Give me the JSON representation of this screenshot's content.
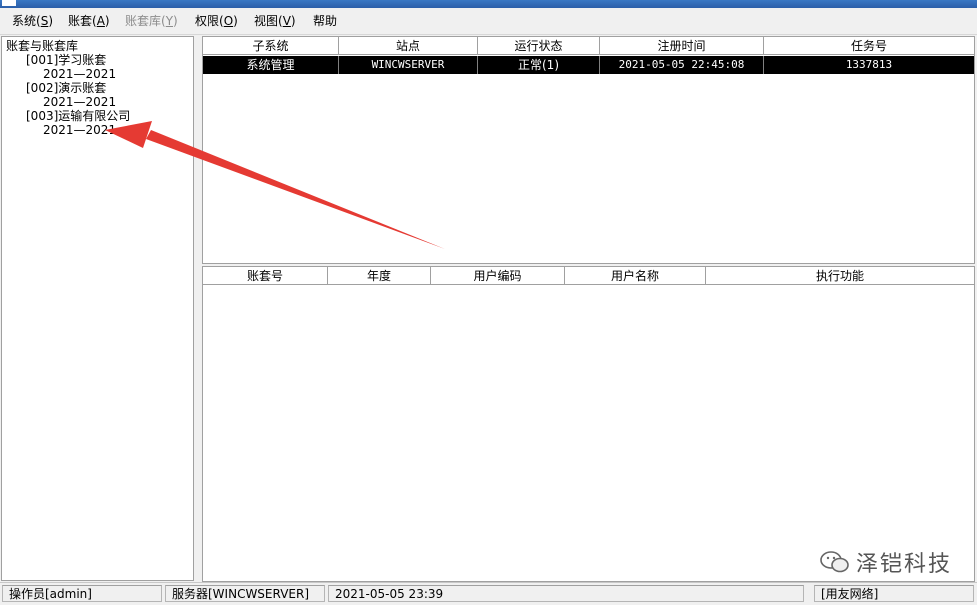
{
  "menubar": {
    "items": [
      {
        "label": "系统(",
        "key": "S",
        "tail": ")"
      },
      {
        "label": "账套(",
        "key": "A",
        "tail": ")"
      },
      {
        "label": "账套库(",
        "key": "Y",
        "tail": ")"
      },
      {
        "label": "权限(",
        "key": "O",
        "tail": ")"
      },
      {
        "label": "视图(",
        "key": "V",
        "tail": ")"
      },
      {
        "label": "帮助",
        "key": "",
        "tail": ""
      }
    ]
  },
  "tree": {
    "root": "账套与账套库",
    "accounts": [
      {
        "label": "[001]学习账套",
        "year": "2021—2021"
      },
      {
        "label": "[002]演示账套",
        "year": "2021—2021"
      },
      {
        "label": "[003]运输有限公司",
        "year": "2021—2021"
      }
    ]
  },
  "top_table": {
    "columns": [
      "子系统",
      "站点",
      "运行状态",
      "注册时间",
      "任务号"
    ],
    "rows": [
      [
        "系统管理",
        "WINCWSERVER",
        "正常(1)",
        "2021-05-05 22:45:08",
        "1337813"
      ]
    ]
  },
  "bottom_table": {
    "columns": [
      "账套号",
      "年度",
      "用户编码",
      "用户名称",
      "执行功能"
    ]
  },
  "watermark": {
    "text": "泽铠科技"
  },
  "statusbar": {
    "operator": "操作员[admin]",
    "server": "服务器[WINCWSERVER]",
    "datetime": "2021-05-05 23:39",
    "network": "[用友网络]"
  },
  "colors": {
    "selection": "#000000",
    "arrow": "#e53a33",
    "titlebar": "#2b5ea8"
  }
}
